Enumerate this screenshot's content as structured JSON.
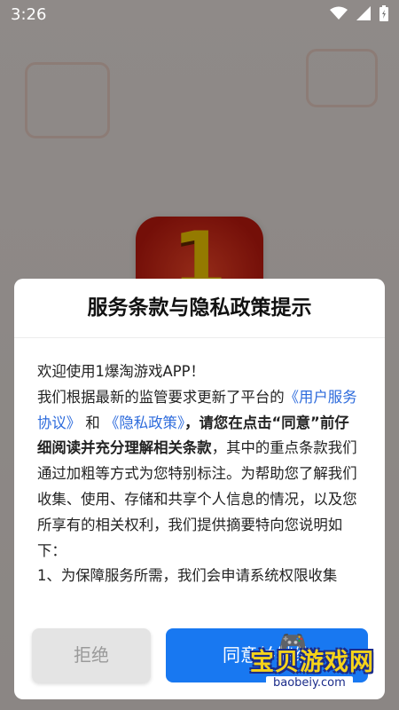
{
  "status_bar": {
    "time": "3:26",
    "icons": [
      "wifi-icon",
      "cell-signal-icon",
      "battery-icon"
    ]
  },
  "background_app": {
    "icon_text": "1"
  },
  "dialog": {
    "title": "服务条款与隐私政策提示",
    "body": {
      "welcome": "欢迎使用1爆淘游戏APP！",
      "p1_pre": "我们根据最新的监管要求更新了平台的",
      "link_user_agreement": "《用户服务协议》",
      "p1_and": "和",
      "link_privacy_policy": "《隐私政策》",
      "p1_bold": "，请您在点击“同意”前仔细阅读并充分理解相关条款",
      "p1_post": "，其中的重点条款我们通过加粗等方式为您特别标注。为帮助您了解我们收集、使用、存储和共享个人信息的情况，以及您所享有的相关权利，我们提供摘要特向您说明如下：",
      "p2": "1、为保障服务所需，我们会申请系统权限收集"
    },
    "buttons": {
      "reject": "拒绝",
      "agree": "同意并继续"
    }
  },
  "watermark": {
    "main": "宝贝游戏网",
    "sub": "baobeiy.com"
  }
}
